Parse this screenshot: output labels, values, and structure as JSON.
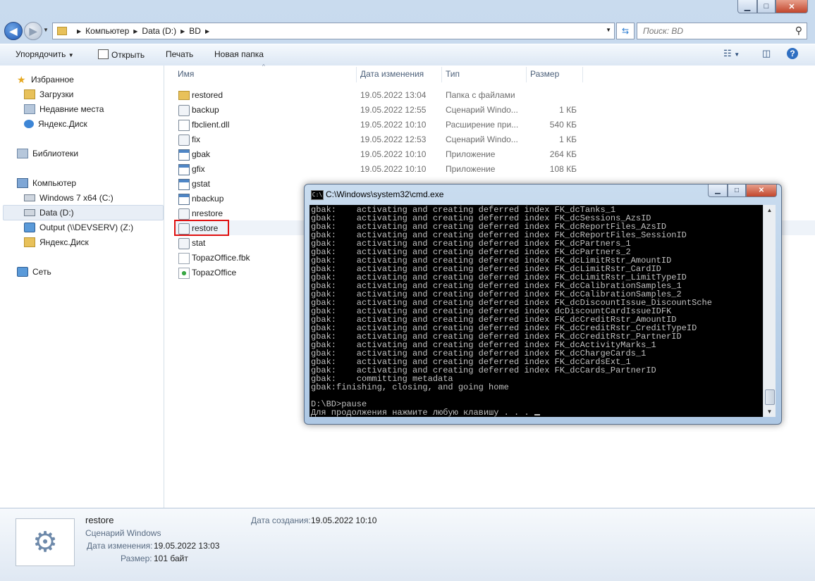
{
  "window": {
    "caption_min": "▁",
    "caption_max": "□",
    "caption_close": "✕"
  },
  "address": {
    "crumbs": [
      "Компьютер",
      "Data (D:)",
      "BD"
    ],
    "search_placeholder": "Поиск: BD"
  },
  "toolbar": {
    "organize": "Упорядочить",
    "open": "Открыть",
    "print": "Печать",
    "new_folder": "Новая папка"
  },
  "nav": {
    "favorites": "Избранное",
    "downloads": "Загрузки",
    "recent": "Недавние места",
    "yandex1": "Яндекс.Диск",
    "libraries": "Библиотеки",
    "computer": "Компьютер",
    "win7": "Windows 7 x64 (C:)",
    "data": "Data (D:)",
    "output": "Output (\\\\DEVSERV) (Z:)",
    "yandex2": "Яндекс.Диск",
    "network": "Сеть"
  },
  "columns": {
    "name": "Имя",
    "date": "Дата изменения",
    "type": "Тип",
    "size": "Размер"
  },
  "files": [
    {
      "name": "restored",
      "date": "19.05.2022 13:04",
      "type": "Папка с файлами",
      "size": "",
      "icon": "folder"
    },
    {
      "name": "backup",
      "date": "19.05.2022 12:55",
      "type": "Сценарий Windo...",
      "size": "1 КБ",
      "icon": "script"
    },
    {
      "name": "fbclient.dll",
      "date": "19.05.2022 10:10",
      "type": "Расширение при...",
      "size": "540 КБ",
      "icon": "dll"
    },
    {
      "name": "fix",
      "date": "19.05.2022 12:53",
      "type": "Сценарий Windo...",
      "size": "1 КБ",
      "icon": "script"
    },
    {
      "name": "gbak",
      "date": "19.05.2022 10:10",
      "type": "Приложение",
      "size": "264 КБ",
      "icon": "app"
    },
    {
      "name": "gfix",
      "date": "19.05.2022 10:10",
      "type": "Приложение",
      "size": "108 КБ",
      "icon": "app"
    },
    {
      "name": "gstat",
      "date": "",
      "type": "",
      "size": "",
      "icon": "app"
    },
    {
      "name": "nbackup",
      "date": "",
      "type": "",
      "size": "",
      "icon": "app"
    },
    {
      "name": "nrestore",
      "date": "",
      "type": "",
      "size": "",
      "icon": "script"
    },
    {
      "name": "restore",
      "date": "",
      "type": "",
      "size": "",
      "icon": "script"
    },
    {
      "name": "stat",
      "date": "",
      "type": "",
      "size": "",
      "icon": "script"
    },
    {
      "name": "TopazOffice.fbk",
      "date": "",
      "type": "",
      "size": "",
      "icon": "fbk"
    },
    {
      "name": "TopazOffice",
      "date": "",
      "type": "",
      "size": "",
      "icon": "topaz"
    }
  ],
  "cmd": {
    "title": "C:\\Windows\\system32\\cmd.exe",
    "lines": [
      "gbak:    activating and creating deferred index FK_dcTanks_1",
      "gbak:    activating and creating deferred index FK_dcSessions_AzsID",
      "gbak:    activating and creating deferred index FK_dcReportFiles_AzsID",
      "gbak:    activating and creating deferred index FK_dcReportFiles_SessionID",
      "gbak:    activating and creating deferred index FK_dcPartners_1",
      "gbak:    activating and creating deferred index FK_dcPartners_2",
      "gbak:    activating and creating deferred index FK_dcLimitRstr_AmountID",
      "gbak:    activating and creating deferred index FK_dcLimitRstr_CardID",
      "gbak:    activating and creating deferred index FK_dcLimitRstr_LimitTypeID",
      "gbak:    activating and creating deferred index FK_dcCalibrationSamples_1",
      "gbak:    activating and creating deferred index FK_dcCalibrationSamples_2",
      "gbak:    activating and creating deferred index FK_dcDiscountIssue_DiscountSche",
      "gbak:    activating and creating deferred index dcDiscountCardIssueIDFK",
      "gbak:    activating and creating deferred index FK_dcCreditRstr_AmountID",
      "gbak:    activating and creating deferred index FK_dcCreditRstr_CreditTypeID",
      "gbak:    activating and creating deferred index FK_dcCreditRstr_PartnerID",
      "gbak:    activating and creating deferred index FK_dcActivityMarks_1",
      "gbak:    activating and creating deferred index FK_dcChargeCards_1",
      "gbak:    activating and creating deferred index FK_dcCardsExt_1",
      "gbak:    activating and creating deferred index FK_dcCards_PartnerID",
      "gbak:    committing metadata",
      "gbak:finishing, closing, and going home",
      "",
      "D:\\BD>pause",
      "Для продолжения нажмите любую клавишу . . . "
    ]
  },
  "details": {
    "name": "restore",
    "kind": "Сценарий Windows",
    "created_label": "Дата создания:",
    "created_value": "19.05.2022 10:10",
    "modified_label": "Дата изменения:",
    "modified_value": "19.05.2022 13:03",
    "size_label": "Размер:",
    "size_value": "101 байт"
  },
  "colors": {
    "highlight": "#e01010",
    "accent": "#1c57b5"
  }
}
